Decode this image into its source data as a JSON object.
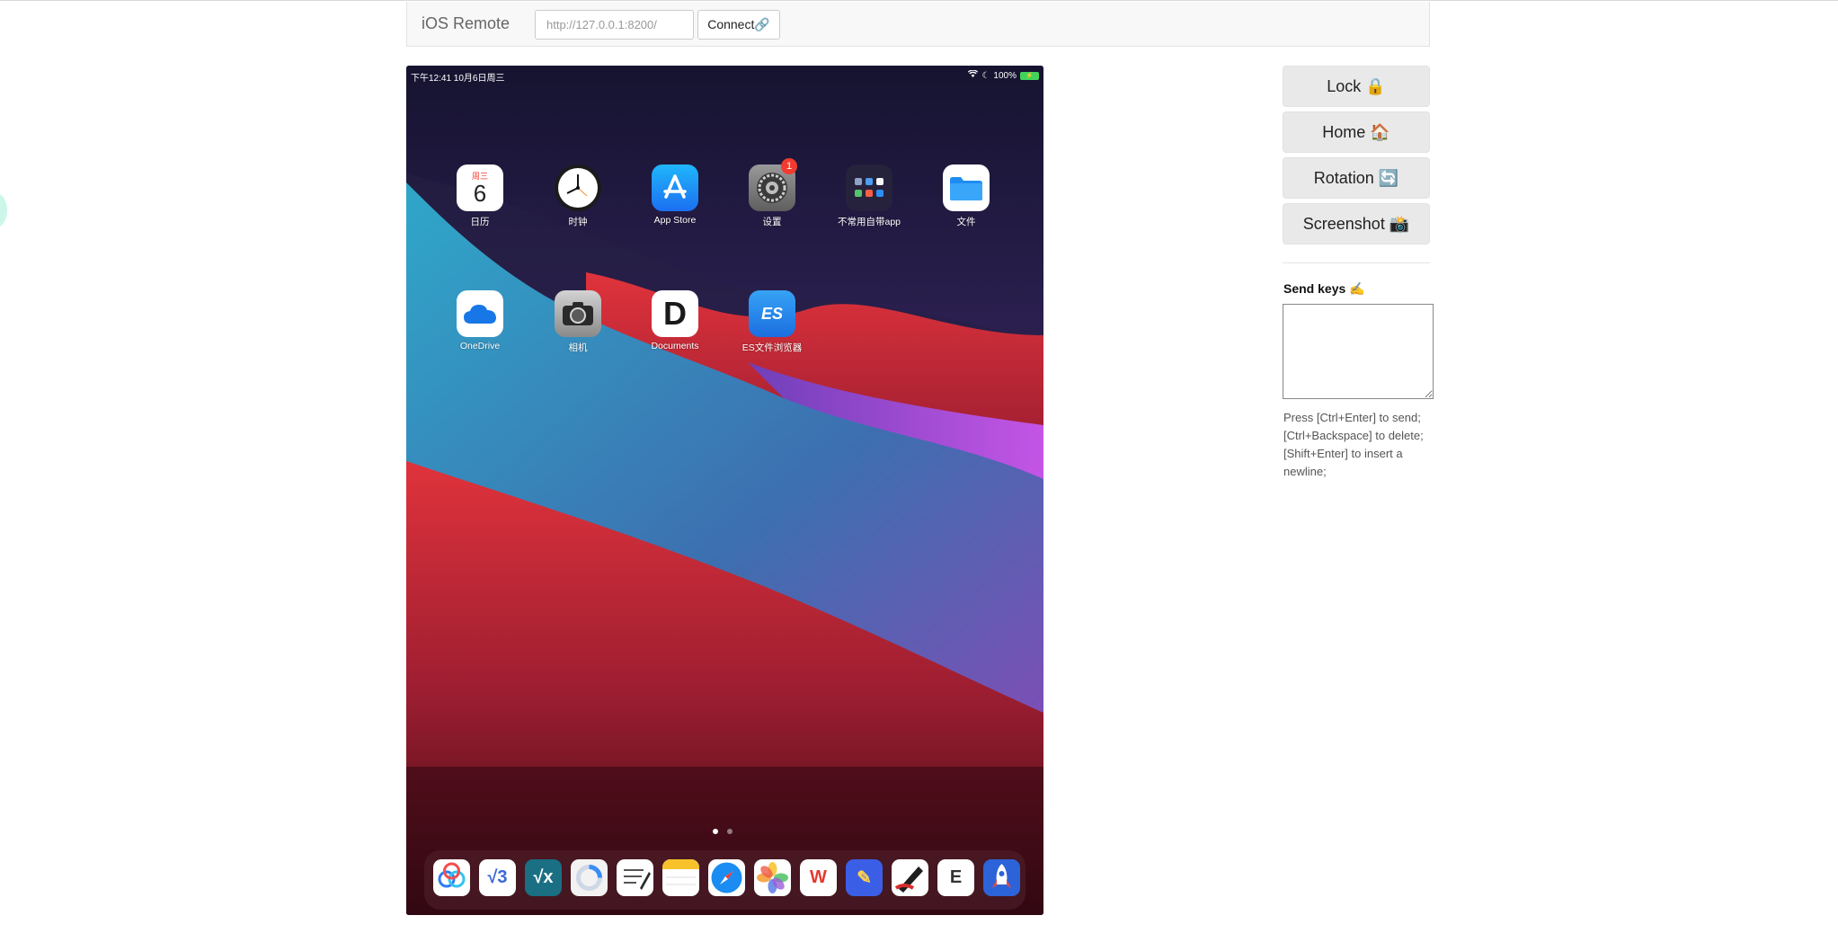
{
  "navbar": {
    "brand": "iOS Remote",
    "url_value": "http://127.0.0.1:8200/",
    "connect_label": "Connect🔗"
  },
  "device": {
    "status": {
      "time_date": "下午12:41   10月6日周三",
      "right": "100%"
    },
    "apps": [
      {
        "label": "日历",
        "icon": "calendar-icon",
        "weekday": "周三",
        "day": "6"
      },
      {
        "label": "时钟",
        "icon": "clock-icon"
      },
      {
        "label": "App Store",
        "icon": "app-store-icon"
      },
      {
        "label": "设置",
        "icon": "settings-icon",
        "badge": "1"
      },
      {
        "label": "不常用自带app",
        "icon": "folder-icon"
      },
      {
        "label": "文件",
        "icon": "files-icon"
      },
      {
        "label": "OneDrive",
        "icon": "onedrive-icon"
      },
      {
        "label": "相机",
        "icon": "camera-icon"
      },
      {
        "label": "Documents",
        "icon": "documents-icon",
        "glyph": "D"
      },
      {
        "label": "ES文件浏览器",
        "icon": "es-file-explorer-icon",
        "glyph": "ES"
      }
    ],
    "page_dots": 2,
    "dock": [
      {
        "name": "baidu-netdisk-icon",
        "glyph": "",
        "bg": "#ffffff",
        "fg": "#2f7bf6"
      },
      {
        "name": "v3-app-icon",
        "glyph": "√3",
        "bg": "#ffffff",
        "fg": "#3a68d8"
      },
      {
        "name": "math-app-icon",
        "glyph": "√x",
        "bg": "#1a6f83",
        "fg": "#ffffff"
      },
      {
        "name": "loading-app-icon",
        "glyph": "",
        "bg": "#f2f2f2",
        "fg": "#3a8ef5"
      },
      {
        "name": "notes-editor-icon",
        "glyph": "",
        "bg": "#ffffff",
        "fg": "#333333"
      },
      {
        "name": "notes-icon",
        "glyph": "",
        "bg": "#fefefe",
        "fg": "#f7c22a"
      },
      {
        "name": "safari-icon",
        "glyph": "",
        "bg": "#1b8cf2",
        "fg": "#ffffff"
      },
      {
        "name": "photos-icon",
        "glyph": "",
        "bg": "#ffffff",
        "fg": "#f29a2e"
      },
      {
        "name": "wps-office-icon",
        "glyph": "W",
        "bg": "#ffffff",
        "fg": "#e8382d"
      },
      {
        "name": "pencil-app-icon",
        "glyph": "✎",
        "bg": "#3b5ee6",
        "fg": "#ffd24a"
      },
      {
        "name": "marker-app-icon",
        "glyph": "",
        "bg": "#ffffff",
        "fg": "#d72b2b"
      },
      {
        "name": "e-reader-icon",
        "glyph": "E",
        "bg": "#ffffff",
        "fg": "#333333"
      },
      {
        "name": "rocket-app-icon",
        "glyph": "",
        "bg": "#2d63d8",
        "fg": "#ffffff"
      }
    ]
  },
  "controls": {
    "lock": "Lock 🔒",
    "home": "Home 🏠",
    "rotation": "Rotation 🔄",
    "screenshot": "Screenshot 📸"
  },
  "send_keys": {
    "title": "Send keys ✍️",
    "help": "Press [Ctrl+Enter] to send; [Ctrl+Backspace] to delete; [Shift+Enter] to insert a newline;"
  },
  "colors": {
    "navbar_bg": "#f8f8f8",
    "button_bg": "#e9e9e9",
    "badge": "#f23b30",
    "battery": "#42d45a"
  }
}
